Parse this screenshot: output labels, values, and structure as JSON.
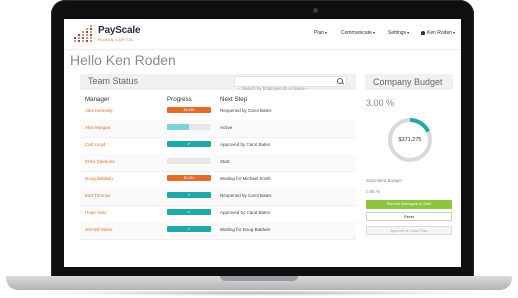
{
  "app": {
    "brand": "PayScale",
    "brand_sub": "HUMAN CAPITAL",
    "colors": {
      "accent_orange": "#e36b2c",
      "accent_teal": "#1fa8a8",
      "light_teal": "#7fd3d8",
      "green": "#8cc63e"
    }
  },
  "nav": {
    "plan": "Plan",
    "communicate": "Communicate",
    "settings": "Settings",
    "user": "Ken Roden"
  },
  "greeting": "Hello Ken Roden",
  "team_status": {
    "title": "Team Status",
    "search_placeholder": "-- Search by Employee ID or Name --",
    "columns": {
      "manager": "Manager",
      "progress": "Progress",
      "next_step": "Next Step"
    },
    "rows": [
      {
        "manager": "Alex Kennedy",
        "progress_label": "$4,450",
        "progress": 1.0,
        "status": "orange",
        "next_step": "Reopened by Carol Bates"
      },
      {
        "manager": "Alex Morgan",
        "progress_label": "",
        "progress": 0.5,
        "status": "light",
        "next_step": "Active"
      },
      {
        "manager": "Carl Lloyd",
        "progress_label": "✔",
        "progress": 1.0,
        "status": "teal",
        "next_step": "Approved by Carol Bates"
      },
      {
        "manager": "Chris Clemons",
        "progress_label": "",
        "progress": 0.0,
        "status": "empty",
        "next_step": "Start"
      },
      {
        "manager": "Doug Baldwin",
        "progress_label": "$4,511",
        "progress": 1.0,
        "status": "orange",
        "next_step": "Waiting for Michael Smith"
      },
      {
        "manager": "Earl Thomas",
        "progress_label": "✔",
        "progress": 1.0,
        "status": "teal",
        "next_step": "Reopened by Carol Bates"
      },
      {
        "manager": "Hope Solo",
        "progress_label": "✔",
        "progress": 1.0,
        "status": "teal",
        "next_step": "Approved by Carol Bates"
      },
      {
        "manager": "Jermell Stone",
        "progress_label": "✔",
        "progress": 1.0,
        "status": "teal",
        "next_step": "Waiting for Doug Baldwin"
      }
    ]
  },
  "company_budget": {
    "title": "Company Budget",
    "percent": "3.00 %",
    "amount": "$371,275",
    "ring_fraction": 0.18,
    "submitted_label": "Submitted Budget",
    "submitted_percent": "0.65 %",
    "remind_button": "Remind Managers to Start",
    "reset_button": "Reset",
    "approve_button": "Approve & Close Plan"
  }
}
